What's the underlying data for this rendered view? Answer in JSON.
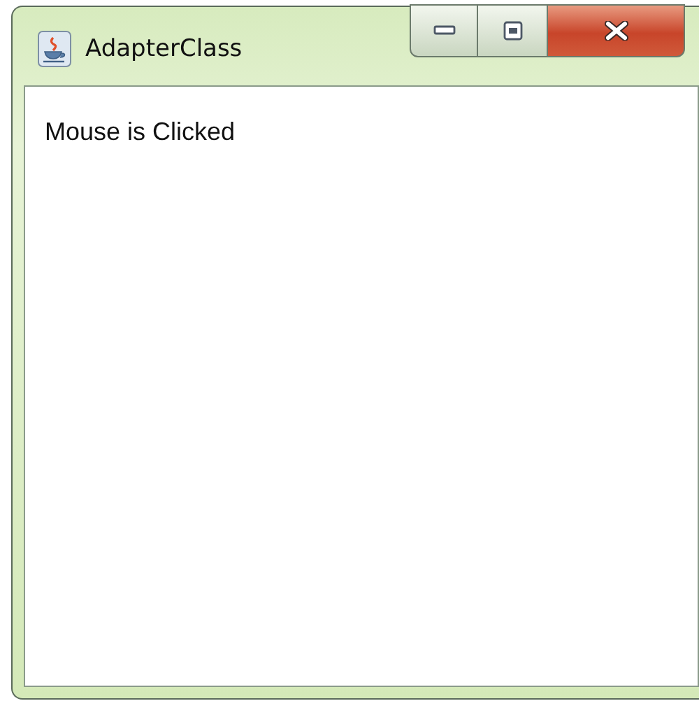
{
  "window": {
    "title": "AdapterClass"
  },
  "content": {
    "message": "Mouse is Clicked"
  }
}
